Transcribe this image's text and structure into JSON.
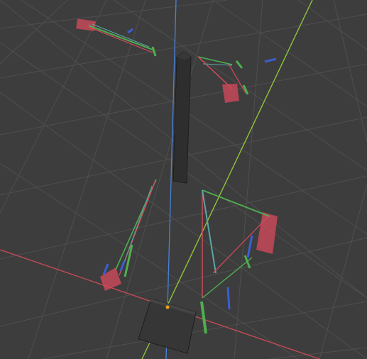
{
  "viewport": {
    "background": "#3d3d3d",
    "grid_color": "#505050",
    "axes": {
      "x_axis_color": "#c44a56",
      "y_axis_color": "#8fc43a",
      "z_axis_color": "#4a82d6"
    },
    "objects": [
      {
        "name": "pillar",
        "color": "#2e2e2e"
      },
      {
        "name": "base-block",
        "color": "#363636"
      },
      {
        "name": "origin-point",
        "color": "#f0a020"
      }
    ],
    "rig_colors": {
      "red": "#d84a5c",
      "green": "#4fae4f",
      "blue": "#3c5fd0",
      "cyan": "#5aa6a6"
    }
  }
}
